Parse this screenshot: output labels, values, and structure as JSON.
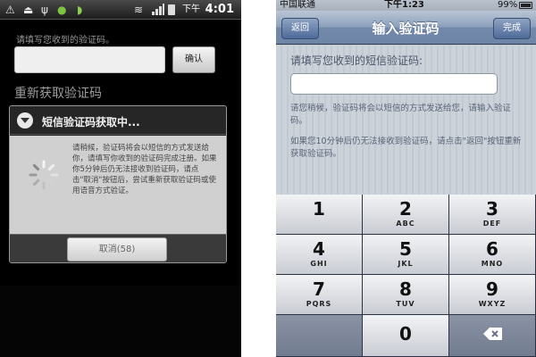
{
  "android": {
    "status": {
      "time": "4:01",
      "ampm": "下午"
    },
    "hint": "请填写您收到的验证码。",
    "confirm_label": "确认",
    "resend_label": "重新获取验证码",
    "dialog": {
      "title": "短信验证码获取中...",
      "message": "请稍候，验证码将会以短信的方式发送给你，请填写你收到的验证码完成注册。如果你5分钟后仍无法接收到验证码，请点击\"取消\"按钮后，尝试重新获取验证码或使用语音方式验证。",
      "cancel_label": "取消(58)"
    }
  },
  "iphone": {
    "status": {
      "carrier": "中国联通",
      "time": "下午1:23",
      "battery": "99%"
    },
    "nav": {
      "back_label": "返回",
      "title": "输入验证码",
      "done_label": "完成"
    },
    "label": "请填写您收到的短信验证码:",
    "paragraph1": "请您稍候，验证码将会以短信的方式发送给您，请输入验证码。",
    "paragraph2": "如果您10分钟后仍无法接收到验证码，请点击\"返回\"按钮重新获取验证码。",
    "keys": [
      {
        "num": "1",
        "letters": ""
      },
      {
        "num": "2",
        "letters": "ABC"
      },
      {
        "num": "3",
        "letters": "DEF"
      },
      {
        "num": "4",
        "letters": "GHI"
      },
      {
        "num": "5",
        "letters": "JKL"
      },
      {
        "num": "6",
        "letters": "MNO"
      },
      {
        "num": "7",
        "letters": "PQRS"
      },
      {
        "num": "8",
        "letters": "TUV"
      },
      {
        "num": "9",
        "letters": "WXYZ"
      },
      {
        "num": "0",
        "letters": ""
      }
    ]
  }
}
